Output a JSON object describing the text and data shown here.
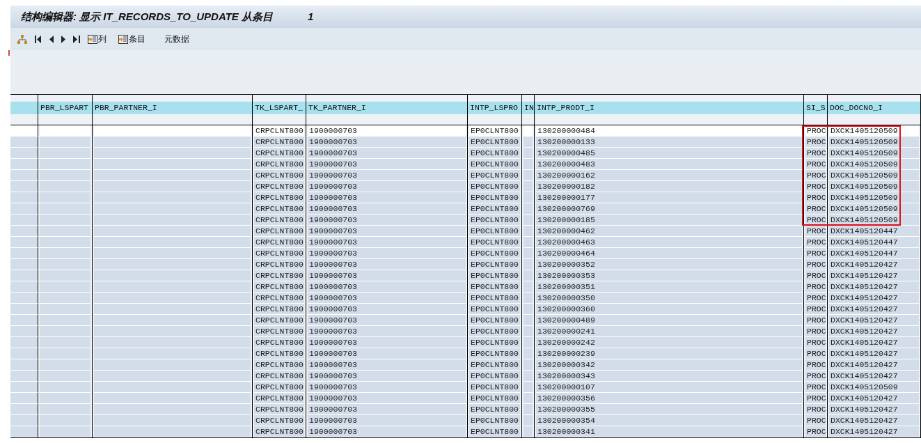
{
  "window": {
    "title": "结构编辑器: 显示 IT_RECORDS_TO_UPDATE 从条目",
    "entry_number": "1"
  },
  "toolbar": [
    {
      "kind": "hierarchy"
    },
    {
      "kind": "first"
    },
    {
      "kind": "previous"
    },
    {
      "kind": "next"
    },
    {
      "kind": "last"
    },
    {
      "kind": "labeled",
      "label": "列"
    },
    {
      "kind": "labeled",
      "label": "条目"
    },
    {
      "kind": "text",
      "label": "元数据"
    }
  ],
  "table": {
    "columns": [
      "PBR_LSPART",
      "PBR_PARTNER_I",
      "TK_LSPART_",
      "TK_PARTNER_I",
      "INTP_LSPRO",
      "IN",
      "INTP_PRODT_I",
      "SI_S",
      "DOC_DOCNO_I"
    ],
    "rows": [
      {
        "selected": true,
        "annotated": true,
        "cells": [
          null,
          null,
          "CRPCLNT800",
          "1900000703",
          "EP0CLNT800",
          null,
          "130200000484",
          "PROC",
          "DXCK1405120509"
        ]
      },
      {
        "selected": false,
        "annotated": true,
        "cells": [
          null,
          null,
          "CRPCLNT800",
          "1900000703",
          "EP0CLNT800",
          null,
          "130200000133",
          "PROC",
          "DXCK1405120509"
        ]
      },
      {
        "selected": false,
        "annotated": true,
        "cells": [
          null,
          null,
          "CRPCLNT800",
          "1900000703",
          "EP0CLNT800",
          null,
          "130200000485",
          "PROC",
          "DXCK1405120509"
        ]
      },
      {
        "selected": false,
        "annotated": true,
        "cells": [
          null,
          null,
          "CRPCLNT800",
          "1900000703",
          "EP0CLNT800",
          null,
          "130200000483",
          "PROC",
          "DXCK1405120509"
        ]
      },
      {
        "selected": false,
        "annotated": true,
        "cells": [
          null,
          null,
          "CRPCLNT800",
          "1900000703",
          "EP0CLNT800",
          null,
          "130200000162",
          "PROC",
          "DXCK1405120509"
        ]
      },
      {
        "selected": false,
        "annotated": true,
        "cells": [
          null,
          null,
          "CRPCLNT800",
          "1900000703",
          "EP0CLNT800",
          null,
          "130200000182",
          "PROC",
          "DXCK1405120509"
        ]
      },
      {
        "selected": false,
        "annotated": true,
        "cells": [
          null,
          null,
          "CRPCLNT800",
          "1900000703",
          "EP0CLNT800",
          null,
          "130200000177",
          "PROC",
          "DXCK1405120509"
        ]
      },
      {
        "selected": false,
        "annotated": true,
        "cells": [
          null,
          null,
          "CRPCLNT800",
          "1900000703",
          "EP0CLNT800",
          null,
          "130200000769",
          "PROC",
          "DXCK1405120509"
        ]
      },
      {
        "selected": false,
        "annotated": true,
        "cells": [
          null,
          null,
          "CRPCLNT800",
          "1900000703",
          "EP0CLNT800",
          null,
          "130200000185",
          "PROC",
          "DXCK1405120509"
        ]
      },
      {
        "selected": false,
        "annotated": false,
        "cells": [
          null,
          null,
          "CRPCLNT800",
          "1900000703",
          "EP0CLNT800",
          null,
          "130200000462",
          "PROC",
          "DXCK1405120447"
        ]
      },
      {
        "selected": false,
        "annotated": false,
        "cells": [
          null,
          null,
          "CRPCLNT800",
          "1900000703",
          "EP0CLNT800",
          null,
          "130200000463",
          "PROC",
          "DXCK1405120447"
        ]
      },
      {
        "selected": false,
        "annotated": false,
        "cells": [
          null,
          null,
          "CRPCLNT800",
          "1900000703",
          "EP0CLNT800",
          null,
          "130200000464",
          "PROC",
          "DXCK1405120447"
        ]
      },
      {
        "selected": false,
        "annotated": false,
        "cells": [
          null,
          null,
          "CRPCLNT800",
          "1900000703",
          "EP0CLNT800",
          null,
          "130200000352",
          "PROC",
          "DXCK1405120427"
        ]
      },
      {
        "selected": false,
        "annotated": false,
        "cells": [
          null,
          null,
          "CRPCLNT800",
          "1900000703",
          "EP0CLNT800",
          null,
          "130200000353",
          "PROC",
          "DXCK1405120427"
        ]
      },
      {
        "selected": false,
        "annotated": false,
        "cells": [
          null,
          null,
          "CRPCLNT800",
          "1900000703",
          "EP0CLNT800",
          null,
          "130200000351",
          "PROC",
          "DXCK1405120427"
        ]
      },
      {
        "selected": false,
        "annotated": false,
        "cells": [
          null,
          null,
          "CRPCLNT800",
          "1900000703",
          "EP0CLNT800",
          null,
          "130200000350",
          "PROC",
          "DXCK1405120427"
        ]
      },
      {
        "selected": false,
        "annotated": false,
        "cells": [
          null,
          null,
          "CRPCLNT800",
          "1900000703",
          "EP0CLNT800",
          null,
          "130200000360",
          "PROC",
          "DXCK1405120427"
        ]
      },
      {
        "selected": false,
        "annotated": false,
        "cells": [
          null,
          null,
          "CRPCLNT800",
          "1900000703",
          "EP0CLNT800",
          null,
          "130200000489",
          "PROC",
          "DXCK1405120427"
        ]
      },
      {
        "selected": false,
        "annotated": false,
        "cells": [
          null,
          null,
          "CRPCLNT800",
          "1900000703",
          "EP0CLNT800",
          null,
          "130200000241",
          "PROC",
          "DXCK1405120427"
        ]
      },
      {
        "selected": false,
        "annotated": false,
        "cells": [
          null,
          null,
          "CRPCLNT800",
          "1900000703",
          "EP0CLNT800",
          null,
          "130200000242",
          "PROC",
          "DXCK1405120427"
        ]
      },
      {
        "selected": false,
        "annotated": false,
        "cells": [
          null,
          null,
          "CRPCLNT800",
          "1900000703",
          "EP0CLNT800",
          null,
          "130200000239",
          "PROC",
          "DXCK1405120427"
        ]
      },
      {
        "selected": false,
        "annotated": false,
        "cells": [
          null,
          null,
          "CRPCLNT800",
          "1900000703",
          "EP0CLNT800",
          null,
          "130200000342",
          "PROC",
          "DXCK1405120427"
        ]
      },
      {
        "selected": false,
        "annotated": false,
        "cells": [
          null,
          null,
          "CRPCLNT800",
          "1900000703",
          "EP0CLNT800",
          null,
          "130200000343",
          "PROC",
          "DXCK1405120427"
        ]
      },
      {
        "selected": false,
        "annotated": false,
        "cells": [
          null,
          null,
          "CRPCLNT800",
          "1900000703",
          "EP0CLNT800",
          null,
          "130200000107",
          "PROC",
          "DXCK1405120509"
        ]
      },
      {
        "selected": false,
        "annotated": false,
        "cells": [
          null,
          null,
          "CRPCLNT800",
          "1900000703",
          "EP0CLNT800",
          null,
          "130200000356",
          "PROC",
          "DXCK1405120427"
        ]
      },
      {
        "selected": false,
        "annotated": false,
        "cells": [
          null,
          null,
          "CRPCLNT800",
          "1900000703",
          "EP0CLNT800",
          null,
          "130200000355",
          "PROC",
          "DXCK1405120427"
        ]
      },
      {
        "selected": false,
        "annotated": false,
        "cells": [
          null,
          null,
          "CRPCLNT800",
          "1900000703",
          "EP0CLNT800",
          null,
          "130200000354",
          "PROC",
          "DXCK1405120427"
        ]
      },
      {
        "selected": false,
        "annotated": false,
        "cells": [
          null,
          null,
          "CRPCLNT800",
          "1900000703",
          "EP0CLNT800",
          null,
          "130200000341",
          "PROC",
          "DXCK1405120427"
        ]
      }
    ]
  }
}
